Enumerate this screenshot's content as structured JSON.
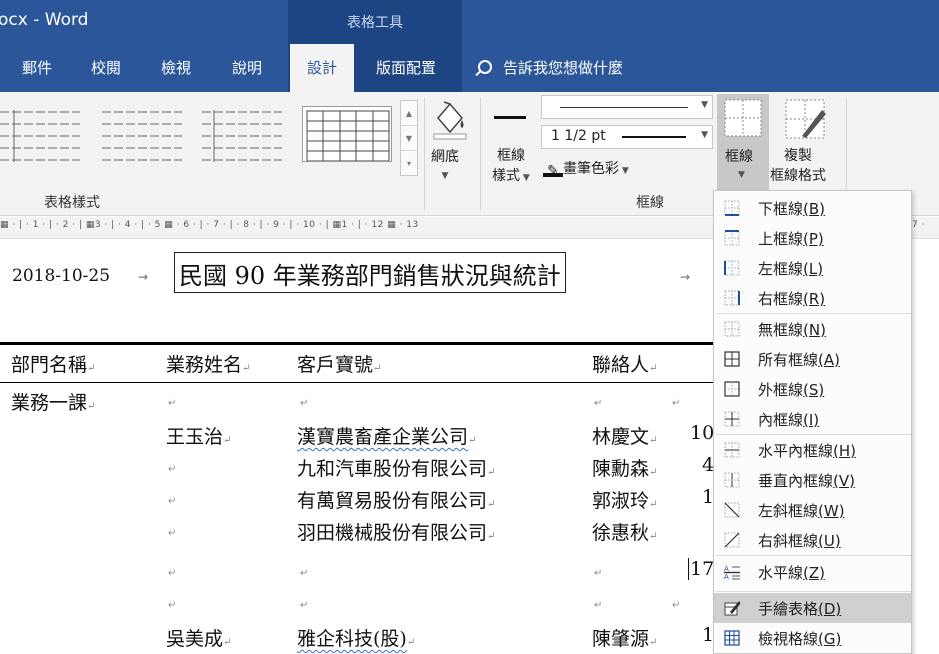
{
  "window": {
    "title": "ocx  -  Word",
    "context_tab": "表格工具"
  },
  "tabs": [
    "郵件",
    "校閱",
    "檢視",
    "說明",
    "設計",
    "版面配置"
  ],
  "tell_me": "告訴我您想做什麼",
  "ribbon": {
    "table_styles_label": "表格樣式",
    "shading_label": "網底",
    "border_styles_line1": "框線",
    "border_styles_line2": "樣式",
    "line_weight": "1 1/2 pt",
    "pen_color": "畫筆色彩",
    "borders_button": "框線",
    "border_painter_line1": "複製",
    "border_painter_line2": "框線格式",
    "borders_group_label": "框線"
  },
  "ruler_text": "▦ · | · 1 · | · 2 · | ▦3 · | · 4 · | · 5 ▦ · 6 · | · 7 · | · 8 · | · 9 · | · 10 · | ▦1 · | · 12 ▦ · 13",
  "ruler_tail": "7 ·",
  "document": {
    "date": "2018-10-25",
    "title": "民國 90 年業務部門銷售狀況與統計",
    "arrow": "→",
    "para_mark": "↵",
    "headers": [
      "部門名稱",
      "業務姓名",
      "客戶寶號",
      "聯絡人"
    ],
    "department": "業務一課",
    "rows": [
      {
        "name": "王玉治",
        "customer": "漢寶農畜產企業公司",
        "contact": "林慶文",
        "extra": "10"
      },
      {
        "name": "",
        "customer": "九和汽車股份有限公司",
        "contact": "陳勳森",
        "extra": "4"
      },
      {
        "name": "",
        "customer": "有萬貿易股份有限公司",
        "contact": "郭淑玲",
        "extra": "1"
      },
      {
        "name": "",
        "customer": "羽田機械股份有限公司",
        "contact": "徐惠秋",
        "extra": ""
      },
      {
        "name": "",
        "customer": "",
        "contact": "",
        "extra": "17"
      },
      {
        "name": "",
        "customer": "",
        "contact": "",
        "extra": ""
      },
      {
        "name": "吳美成",
        "customer": "雅企科技(股)",
        "contact": "陳肇源",
        "extra": "1"
      }
    ]
  },
  "border_menu": [
    {
      "label": "下框線",
      "key": "(B)",
      "icon": "bottom-border-icon"
    },
    {
      "label": "上框線",
      "key": "(P)",
      "icon": "top-border-icon"
    },
    {
      "label": "左框線",
      "key": "(L)",
      "icon": "left-border-icon"
    },
    {
      "label": "右框線",
      "key": "(R)",
      "icon": "right-border-icon"
    },
    {
      "label": "無框線",
      "key": "(N)",
      "icon": "no-border-icon"
    },
    {
      "label": "所有框線",
      "key": "(A)",
      "icon": "all-borders-icon"
    },
    {
      "label": "外框線",
      "key": "(S)",
      "icon": "outside-borders-icon"
    },
    {
      "label": "內框線",
      "key": "(I)",
      "icon": "inside-borders-icon"
    },
    {
      "label": "水平內框線",
      "key": "(H)",
      "icon": "inside-horizontal-border-icon"
    },
    {
      "label": "垂直內框線",
      "key": "(V)",
      "icon": "inside-vertical-border-icon"
    },
    {
      "label": "左斜框線",
      "key": "(W)",
      "icon": "diagonal-down-border-icon"
    },
    {
      "label": "右斜框線",
      "key": "(U)",
      "icon": "diagonal-up-border-icon"
    },
    {
      "label": "水平線",
      "key": "(Z)",
      "icon": "horizontal-line-icon"
    },
    {
      "label": "手繪表格",
      "key": "(D)",
      "icon": "draw-table-icon"
    },
    {
      "label": "檢視格線",
      "key": "(G)",
      "icon": "view-gridlines-icon"
    }
  ],
  "colors": {
    "title_bar": "#2b579a",
    "context_band": "#1e4583",
    "ribbon_bg": "#f3f3f3",
    "menu_hover": "#d0d0d0"
  }
}
